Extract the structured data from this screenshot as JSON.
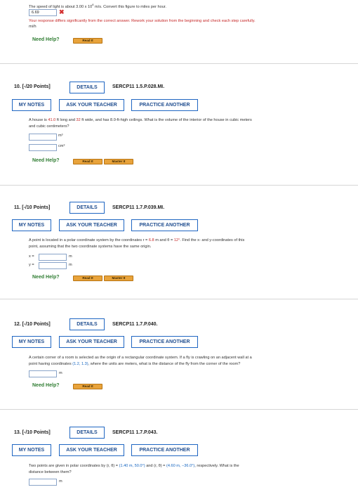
{
  "q9": {
    "text_pre": "The speed of light is about 3.00 ",
    "text_x": "x",
    "text_pow": " 10",
    "text_exp": "8",
    "text_post": " m/s. Convert this figure to miles per hour.",
    "answer": "6.69",
    "error": "Your response differs significantly from the correct answer. Rework your solution from the beginning and check each step carefully.",
    "unit": "mi/h",
    "need_help": "Need Help?",
    "read_it": "Read It"
  },
  "q10": {
    "number": "10.  [-/20 Points]",
    "details": "DETAILS",
    "code": "SERCP11 1.5.P.028.MI.",
    "my_notes": "MY NOTES",
    "ask": "ASK YOUR TEACHER",
    "practice": "PRACTICE ANOTHER",
    "text_a": "A house is ",
    "len": "41.0",
    "text_b": " ft long and ",
    "wid": "32",
    "text_c": " ft wide, and has 8.0-ft-high ceilings. What is the volume of the interior of the house in cubic meters",
    "text_d": "and cubic centimeters?",
    "unit1": "m³",
    "unit2": "cm³",
    "need_help": "Need Help?",
    "read_it": "Read It",
    "master_it": "Master It"
  },
  "q11": {
    "number": "11.  [-/10 Points]",
    "details": "DETAILS",
    "code": "SERCP11 1.7.P.039.MI.",
    "my_notes": "MY NOTES",
    "ask": "ASK YOUR TEACHER",
    "practice": "PRACTICE ANOTHER",
    "text_a": "A point is located in a polar coordinate system by the coordinates r = ",
    "r": "6.8",
    "text_b": " m and θ = ",
    "theta": "12°",
    "text_c": ". Find the x- and y-coordinates of this",
    "text_d": "point, assuming that the two coordinate systems have the same origin.",
    "x_label": "x =",
    "y_label": "y =",
    "unit": "m",
    "need_help": "Need Help?",
    "read_it": "Read It",
    "master_it": "Master It"
  },
  "q12": {
    "number": "12.  [-/10 Points]",
    "details": "DETAILS",
    "code": "SERCP11 1.7.P.040.",
    "my_notes": "MY NOTES",
    "ask": "ASK YOUR TEACHER",
    "practice": "PRACTICE ANOTHER",
    "text_a": "A certain corner of a room is selected as the origin of a rectangular coordinate system. If a fly is crawling on an adjacent wall at a",
    "text_b": "point having coordinates ",
    "coords": "(1.2, 1.3)",
    "text_c": ", where the units are meters, what is the distance of the fly from the corner of the room?",
    "unit": "m",
    "need_help": "Need Help?",
    "read_it": "Read It"
  },
  "q13": {
    "number": "13.  [-/10 Points]",
    "details": "DETAILS",
    "code": "SERCP11 1.7.P.043.",
    "my_notes": "MY NOTES",
    "ask": "ASK YOUR TEACHER",
    "practice": "PRACTICE ANOTHER",
    "text_a": "Two points are given in polar coordinates by (r, θ) = ",
    "p1": "(1.40 m, 50.0°)",
    "text_b": " and (r, θ) = ",
    "p2": "(4.60 m, −36.0°)",
    "text_c": ", respectively. What is the",
    "text_d": "distance between them?",
    "unit": "m"
  },
  "colors": {
    "accent_blue": "#1f66c2",
    "error_red": "#c62828",
    "help_green": "#2f7d32",
    "pill_orange": "#e8a33b"
  }
}
